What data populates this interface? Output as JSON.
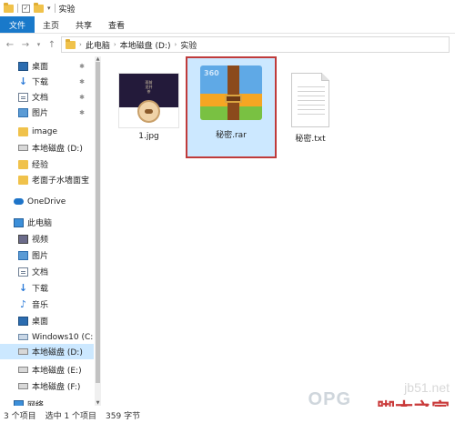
{
  "window": {
    "title": "实验",
    "quick_access": [
      "folder-icon",
      "checkbox-icon",
      "folder-icon",
      "dropdown-icon"
    ]
  },
  "ribbon": {
    "tabs": [
      "文件",
      "主页",
      "共享",
      "查看"
    ]
  },
  "address": {
    "crumbs": [
      "此电脑",
      "本地磁盘 (D:)",
      "实验"
    ]
  },
  "nav": {
    "quick_access": [
      {
        "label": "桌面",
        "icon": "desktop-icon",
        "pinned": true
      },
      {
        "label": "下载",
        "icon": "download-icon",
        "pinned": true
      },
      {
        "label": "文档",
        "icon": "documents-icon",
        "pinned": true
      },
      {
        "label": "图片",
        "icon": "pictures-icon",
        "pinned": true
      },
      {
        "label": "image",
        "icon": "folder-icon"
      },
      {
        "label": "本地磁盘 (D:)",
        "icon": "drive-icon"
      },
      {
        "label": "经验",
        "icon": "folder-icon"
      },
      {
        "label": "老面子水墙面宝",
        "icon": "folder-icon"
      }
    ],
    "onedrive": "OneDrive",
    "this_pc": "此电脑",
    "pc_items": [
      {
        "label": "视频",
        "icon": "videos-icon"
      },
      {
        "label": "图片",
        "icon": "pictures-icon"
      },
      {
        "label": "文档",
        "icon": "documents-icon"
      },
      {
        "label": "下载",
        "icon": "download-icon"
      },
      {
        "label": "音乐",
        "icon": "music-icon"
      },
      {
        "label": "桌面",
        "icon": "desktop-icon"
      },
      {
        "label": "Windows10 (C:",
        "icon": "windows-drive-icon"
      },
      {
        "label": "本地磁盘 (D:)",
        "icon": "drive-icon",
        "selected": true
      },
      {
        "label": "本地磁盘 (E:)",
        "icon": "drive-icon"
      },
      {
        "label": "本地磁盘 (F:)",
        "icon": "drive-icon"
      }
    ],
    "network": "网络"
  },
  "files": [
    {
      "name": "1.jpg",
      "type": "image",
      "thumb_text": "雨前龙井茶"
    },
    {
      "name": "秘密.rar",
      "type": "archive",
      "selected": true,
      "badge": "360"
    },
    {
      "name": "秘密.txt",
      "type": "text"
    }
  ],
  "status": {
    "count": "3 个项目",
    "selection": "选中 1 个项目",
    "size": "359 字节"
  },
  "watermark": {
    "logo": "OPG",
    "url": "jb51.net",
    "name": "脚本之家"
  },
  "colors": {
    "accent": "#1979ca",
    "selection": "#cce8ff",
    "highlight_border": "#bf3b3b"
  }
}
